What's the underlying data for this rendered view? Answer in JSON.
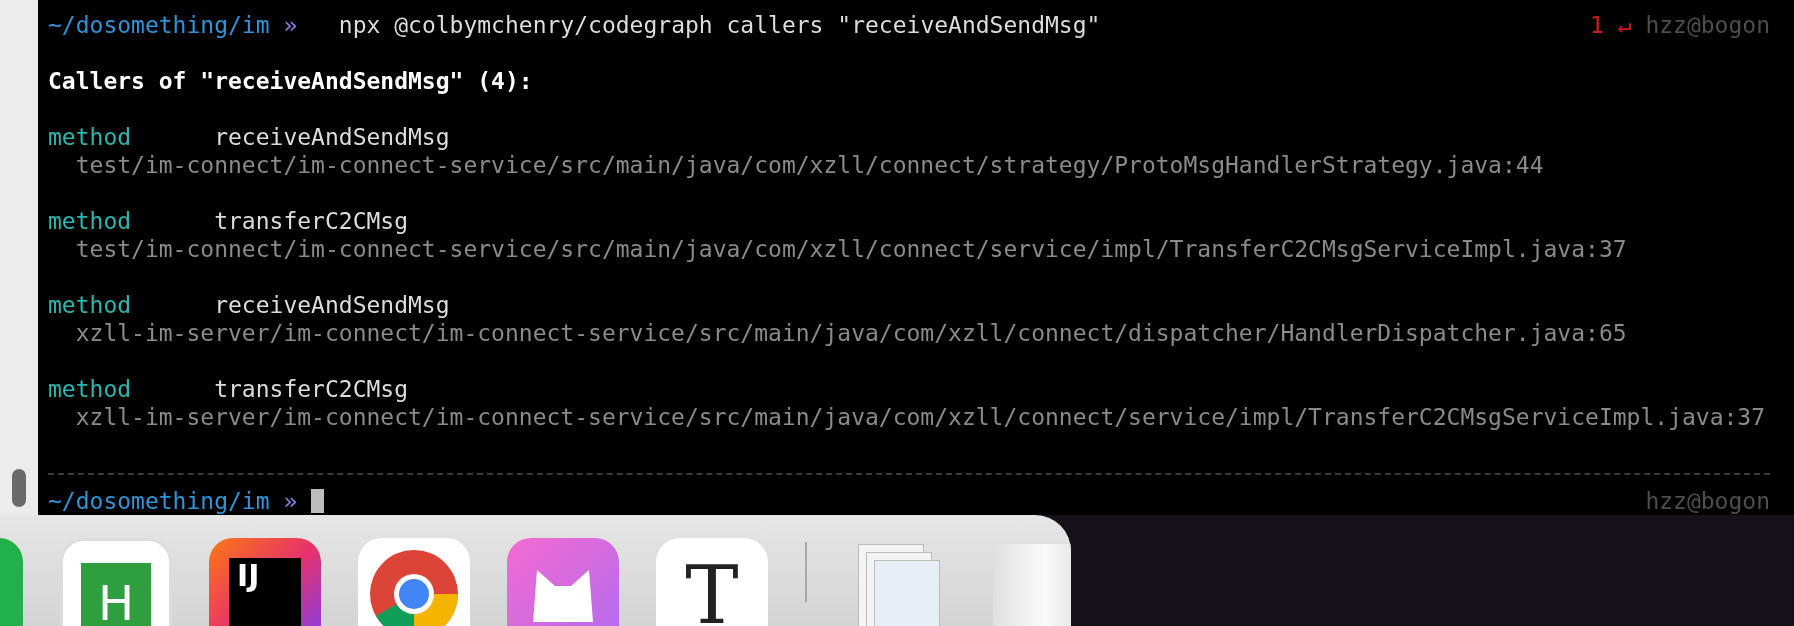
{
  "terminal": {
    "prompt": {
      "path": "~/dosomething/im",
      "symbol": "»",
      "command": "npx @colbymchenry/codegraph callers \"receiveAndSendMsg\"",
      "exit_code": "1",
      "exit_symbol": "↵",
      "host": "hzz@bogon"
    },
    "heading": "Callers of \"receiveAndSendMsg\" (4):",
    "results": [
      {
        "type_label": "method",
        "name": "receiveAndSendMsg",
        "location": "test/im-connect/im-connect-service/src/main/java/com/xzll/connect/strategy/ProtoMsgHandlerStrategy.java:44"
      },
      {
        "type_label": "method",
        "name": "transferC2CMsg",
        "location": "test/im-connect/im-connect-service/src/main/java/com/xzll/connect/service/impl/TransferC2CMsgServiceImpl.java:37"
      },
      {
        "type_label": "method",
        "name": "receiveAndSendMsg",
        "location": "xzll-im-server/im-connect/im-connect-service/src/main/java/com/xzll/connect/dispatcher/HandlerDispatcher.java:65"
      },
      {
        "type_label": "method",
        "name": "transferC2CMsg",
        "location": "xzll-im-server/im-connect/im-connect-service/src/main/java/com/xzll/connect/service/impl/TransferC2CMsgServiceImpl.java:37"
      }
    ],
    "next_prompt": {
      "path": "~/dosomething/im",
      "symbol": "»",
      "host": "hzz@bogon"
    }
  },
  "dock": {
    "items": [
      {
        "kind": "green"
      },
      {
        "kind": "html",
        "glyph": "H"
      },
      {
        "kind": "ij",
        "glyph": "IJ"
      },
      {
        "kind": "chrome"
      },
      {
        "kind": "cat"
      },
      {
        "kind": "typora",
        "glyph": "T"
      },
      {
        "kind": "separator"
      },
      {
        "kind": "docs"
      },
      {
        "kind": "trash"
      }
    ]
  }
}
